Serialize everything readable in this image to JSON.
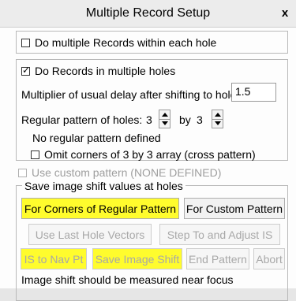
{
  "window": {
    "title": "Multiple Record Setup",
    "close_label": "x"
  },
  "checkboxes": {
    "multiple_records": {
      "label": "Do multiple Records within each hole",
      "checked": false
    },
    "records_multiple_holes": {
      "label": "Do Records in multiple holes",
      "checked": true
    },
    "omit_corners": {
      "label": "Omit corners of 3 by 3 array (cross pattern)",
      "checked": false
    },
    "custom_pattern": {
      "label": "Use custom pattern (NONE DEFINED)",
      "checked": false,
      "disabled": true
    }
  },
  "multiplier": {
    "label": "Multiplier of usual delay after shifting to hole:",
    "value": "1.5"
  },
  "pattern": {
    "label": "Regular pattern of holes:",
    "x_value": "3",
    "by_label": "by",
    "y_value": "3"
  },
  "status_text": "No regular pattern defined",
  "group": {
    "title": "Save image shift values at holes",
    "buttons": {
      "corners": "For Corners of Regular Pattern",
      "custom": "For Custom Pattern",
      "last_vectors": "Use Last Hole Vectors",
      "step_adjust": "Step To and Adjust IS",
      "is_nav": "IS to Nav Pt",
      "save_shift": "Save Image Shift",
      "end_pattern": "End Pattern",
      "abort": "Abort"
    },
    "note": "Image shift should be measured near focus"
  },
  "colors": {
    "highlight": "#fffc2d",
    "disabled_text": "#a8a8a8"
  }
}
